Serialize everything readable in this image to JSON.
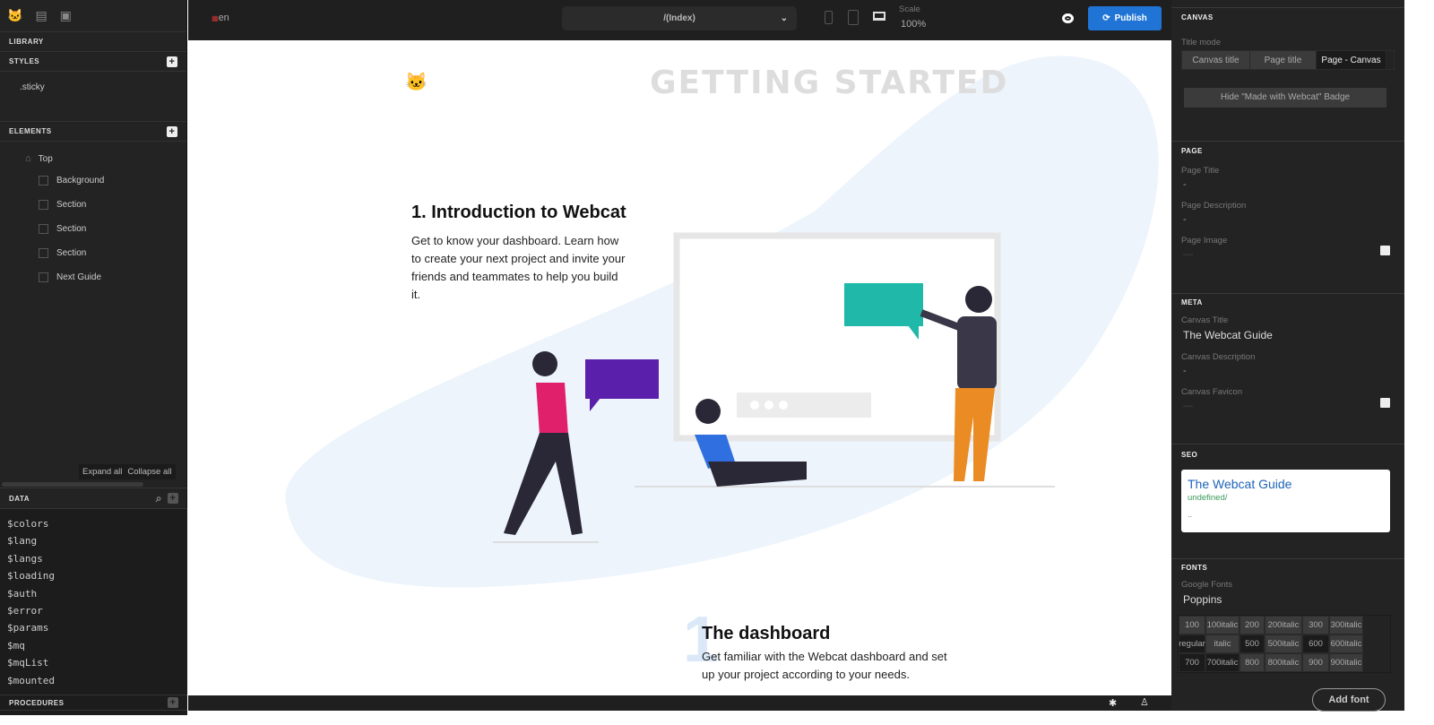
{
  "left": {
    "library": "LIBRARY",
    "styles": {
      "title": "STYLES",
      "items": [
        ".sticky"
      ]
    },
    "elements": {
      "title": "ELEMENTS",
      "root": "Top",
      "items": [
        "Background",
        "Section",
        "Section",
        "Section",
        "Next Guide"
      ]
    },
    "expand_all": "Expand all",
    "collapse_all": "Collapse all",
    "data": {
      "title": "DATA",
      "items": [
        "$colors",
        "$lang",
        "$langs",
        "$loading",
        "$auth",
        "$error",
        "$params",
        "$mq",
        "$mqList",
        "$mounted"
      ]
    },
    "procedures": "PROCEDURES"
  },
  "topbar": {
    "lang": "en",
    "route": "/(Index)",
    "scale_label": "Scale",
    "scale_value": "100%",
    "publish": "Publish",
    "accent": "#1f74d6"
  },
  "canvas": {
    "hero_title": "GETTING STARTED",
    "section1_title": "1. Introduction to Webcat",
    "section1_text": "Get to know your dashboard. Learn how to create your next project and invite your friends and teammates to help you build it.",
    "section2_number": "1",
    "section2_title": "The dashboard",
    "section2_text": "Get familiar with the Webcat dashboard and set up your project according to your needs."
  },
  "right": {
    "canvas": {
      "title": "CANVAS",
      "title_mode_label": "Title mode",
      "title_modes": [
        "Canvas title",
        "Page title",
        "Page - Canvas"
      ],
      "selected_mode": "Page - Canvas",
      "hide_badge": "Hide \"Made with Webcat\" Badge"
    },
    "page": {
      "title": "PAGE",
      "page_title_label": "Page Title",
      "page_title": "-",
      "page_desc_label": "Page Description",
      "page_desc": "-",
      "page_image_label": "Page Image",
      "page_image": "—"
    },
    "meta": {
      "title": "META",
      "canvas_title_label": "Canvas Title",
      "canvas_title": "The Webcat Guide",
      "canvas_desc_label": "Canvas Description",
      "canvas_desc": "-",
      "favicon_label": "Canvas Favicon",
      "favicon": "—"
    },
    "seo": {
      "title": "SEO",
      "preview_title": "The Webcat Guide",
      "preview_url": "undefined/",
      "preview_desc": ".."
    },
    "fonts": {
      "title": "FONTS",
      "source_label": "Google Fonts",
      "family": "Poppins",
      "weights": [
        {
          "v": "100",
          "on": false
        },
        {
          "v": "100italic",
          "on": false
        },
        {
          "v": "200",
          "on": false
        },
        {
          "v": "200italic",
          "on": false
        },
        {
          "v": "300",
          "on": false
        },
        {
          "v": "300italic",
          "on": false
        },
        {
          "v": "regular",
          "on": true
        },
        {
          "v": "italic",
          "on": false
        },
        {
          "v": "500",
          "on": true
        },
        {
          "v": "500italic",
          "on": false
        },
        {
          "v": "600",
          "on": true
        },
        {
          "v": "600italic",
          "on": false
        },
        {
          "v": "700",
          "on": true
        },
        {
          "v": "700italic",
          "on": true
        },
        {
          "v": "800",
          "on": false
        },
        {
          "v": "800italic",
          "on": false
        },
        {
          "v": "900",
          "on": false
        },
        {
          "v": "900italic",
          "on": false
        }
      ],
      "add_font": "Add font"
    }
  }
}
